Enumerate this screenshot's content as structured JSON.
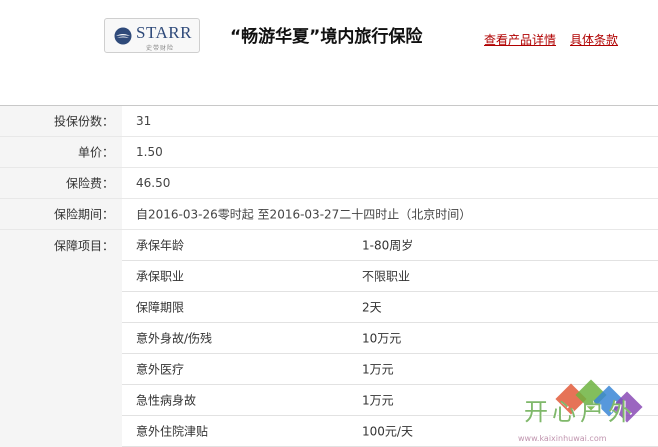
{
  "header": {
    "logo": {
      "brand": "STARR",
      "sub": "史带财险",
      "emblem_color": "#2f4a7a"
    },
    "title": "“畅游华夏”境内旅行保险",
    "links": {
      "detail": "查看产品详情",
      "terms": "具体条款"
    },
    "link_color": "#b00000"
  },
  "order": {
    "copies_label": "投保份数：",
    "copies": "31",
    "price_label": "单价：",
    "price": "1.50",
    "premium_label": "保险费：",
    "premium": "46.50",
    "period_label": "保险期间：",
    "period": "自2016-03-26零时起 至2016-03-27二十四时止（北京时间）"
  },
  "coverage": {
    "label": "保障项目：",
    "items": [
      {
        "name": "承保年龄",
        "value": "1-80周岁"
      },
      {
        "name": "承保职业",
        "value": "不限职业"
      },
      {
        "name": "保障期限",
        "value": "2天"
      },
      {
        "name": "意外身故/伤残",
        "value": "10万元"
      },
      {
        "name": "意外医疗",
        "value": "1万元"
      },
      {
        "name": "急性病身故",
        "value": "1万元"
      },
      {
        "name": "意外住院津贴",
        "value": "100元/天"
      }
    ]
  },
  "watermark": {
    "text": "开心户外",
    "url": "www.kaixinhuwai.com"
  }
}
